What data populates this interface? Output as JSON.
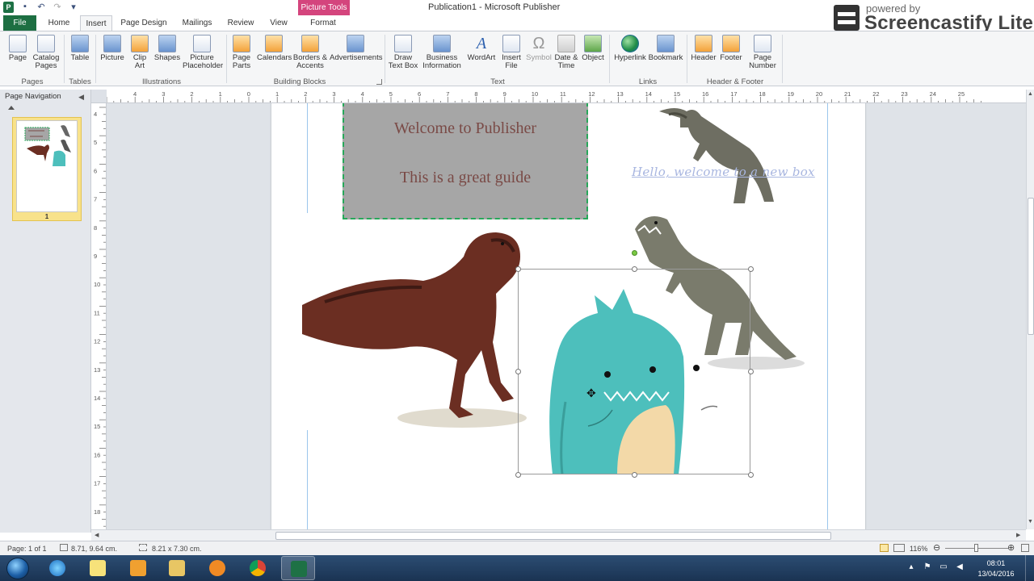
{
  "window": {
    "title": "Publication1 - Microsoft Publisher",
    "contextual_group": "Picture Tools",
    "app_icon_letter": "P"
  },
  "watermark": {
    "line1": "powered by",
    "line2": "Screencastify Lite"
  },
  "tabs": [
    {
      "label": "File"
    },
    {
      "label": "Home"
    },
    {
      "label": "Insert"
    },
    {
      "label": "Page Design"
    },
    {
      "label": "Mailings"
    },
    {
      "label": "Review"
    },
    {
      "label": "View"
    },
    {
      "label": "Format"
    }
  ],
  "ribbon": {
    "groups": {
      "pages": "Pages",
      "tables": "Tables",
      "illustrations": "Illustrations",
      "building_blocks": "Building Blocks",
      "text": "Text",
      "links": "Links",
      "header_footer": "Header & Footer"
    },
    "buttons": {
      "page": "Page",
      "catalog_pages": "Catalog Pages",
      "table": "Table",
      "picture": "Picture",
      "clip_art": "Clip Art",
      "shapes": "Shapes",
      "picture_placeholder": "Picture Placeholder",
      "page_parts": "Page Parts",
      "calendars": "Calendars",
      "borders_accents": "Borders & Accents",
      "advertisements": "Advertisements",
      "draw_text_box": "Draw Text Box",
      "business_information": "Business Information",
      "wordart": "WordArt",
      "insert_file": "Insert File",
      "symbol": "Symbol",
      "date_time": "Date & Time",
      "object": "Object",
      "hyperlink": "Hyperlink",
      "bookmark": "Bookmark",
      "header": "Header",
      "footer": "Footer",
      "page_number": "Page Number"
    }
  },
  "nav_pane": {
    "title": "Page Navigation",
    "collapse_glyph": "◀",
    "page_number": "1"
  },
  "ruler": {
    "top": [
      "4",
      "3",
      "2",
      "1",
      "0",
      "1",
      "2",
      "3",
      "4",
      "5",
      "6",
      "7",
      "8",
      "9",
      "10",
      "11",
      "12",
      "13",
      "14",
      "15",
      "16",
      "17",
      "18",
      "19",
      "20",
      "21",
      "22",
      "23",
      "24",
      "25"
    ],
    "left": [
      "4",
      "5",
      "6",
      "7",
      "8",
      "9",
      "10",
      "11",
      "12",
      "13",
      "14",
      "15",
      "16",
      "17",
      "18"
    ]
  },
  "document": {
    "textbox_line1": "Welcome to  Publisher",
    "textbox_line2": "This is a great guide",
    "hello_text": "Hello, welcome to a new box"
  },
  "status": {
    "page": "Page: 1 of 1",
    "position": "8.71, 9.64 cm.",
    "size": "8.21 x  7.30 cm.",
    "zoom": "116%",
    "zoom_level": 0.5
  },
  "taskbar": {
    "time": "08:01",
    "date": "13/04/2016"
  },
  "colors": {
    "file_tab": "#1d6f42",
    "picture_tools": "#d4457d",
    "textbox_border": "#27a85a",
    "textbox_fill": "#a6a6a6",
    "textbox_text": "#7a4a46",
    "hello_text": "#a8b6e0",
    "monster": "#4dbfbc"
  }
}
